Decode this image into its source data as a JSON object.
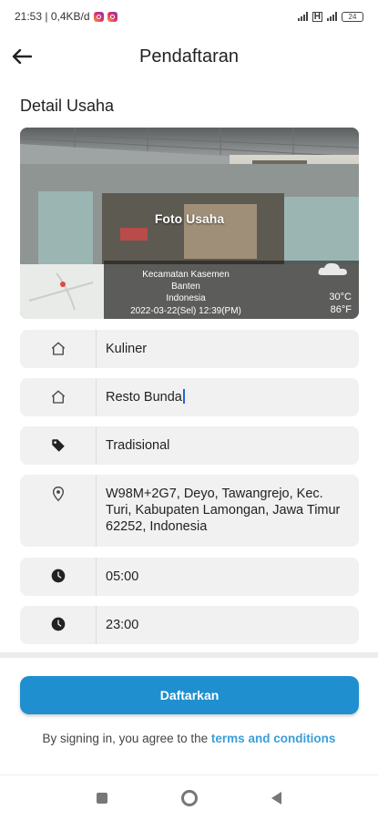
{
  "status_bar": {
    "time_speed": "21:53 | 0,4KB/d",
    "battery": "24"
  },
  "app_bar": {
    "title": "Pendaftaran"
  },
  "section": {
    "title": "Detail Usaha"
  },
  "photo": {
    "label": "Foto Usaha",
    "overlay_district": "Kecamatan Kasemen",
    "overlay_province": "Banten",
    "overlay_country": "Indonesia",
    "overlay_datetime": "2022-03-22(Sel)   12:39(PM)",
    "overlay_temp_c": "30°C",
    "overlay_temp_f": "86°F"
  },
  "fields": {
    "category": "Kuliner",
    "business_name": "Resto Bunda",
    "type": "Tradisional",
    "address": "W98M+2G7, Deyo, Tawangrejo, Kec. Turi, Kabupaten Lamongan, Jawa Timur 62252, Indonesia",
    "open_time": "05:00",
    "close_time": "23:00"
  },
  "submit": {
    "label": "Daftarkan"
  },
  "terms": {
    "prefix": "By signing in, you agree to the ",
    "link": "terms and conditions"
  },
  "colors": {
    "primary": "#1f8fcf",
    "link": "#3a9fd8",
    "field_bg": "#f1f1f1"
  }
}
